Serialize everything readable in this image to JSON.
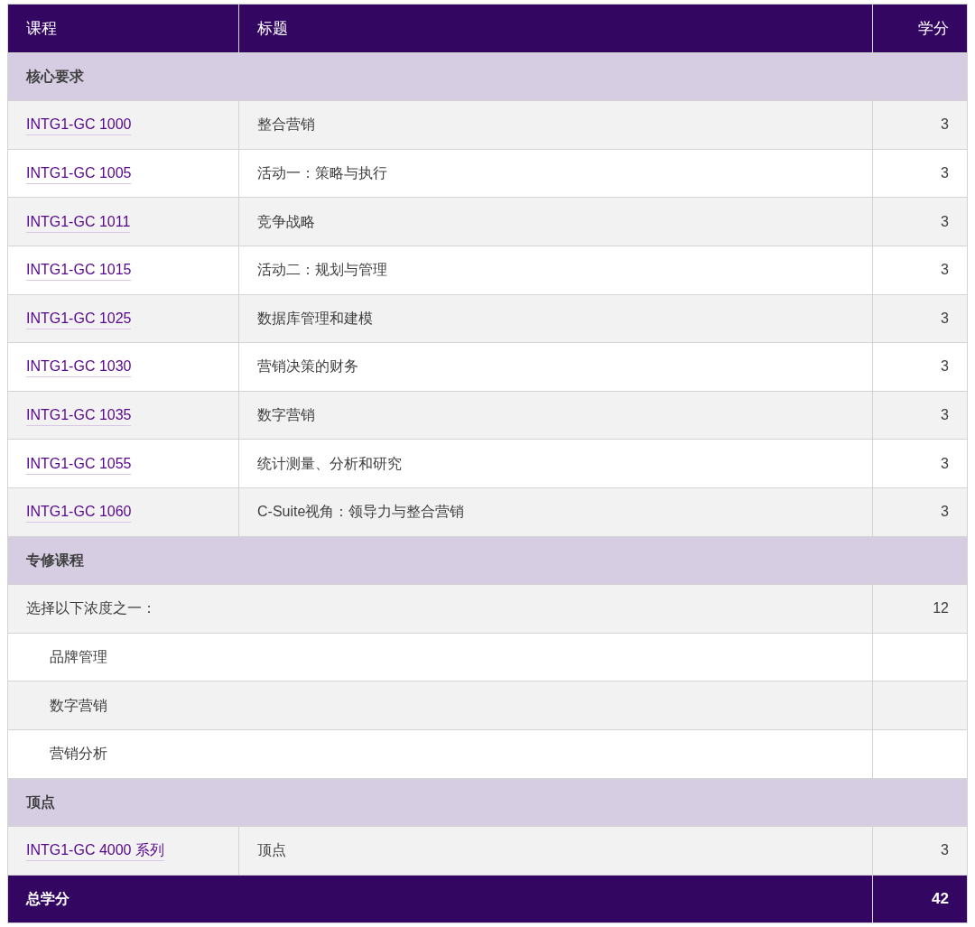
{
  "table": {
    "columns": [
      "课程",
      "标题",
      "学分"
    ],
    "sections": [
      {
        "title": "核心要求",
        "rows": [
          {
            "kind": "course",
            "code": "INTG1-GC 1000",
            "title": "整合营销",
            "credits": "3"
          },
          {
            "kind": "course",
            "code": "INTG1-GC 1005",
            "title": "活动一：策略与执行",
            "credits": "3"
          },
          {
            "kind": "course",
            "code": "INTG1-GC 1011",
            "title": "竞争战略",
            "credits": "3"
          },
          {
            "kind": "course",
            "code": "INTG1-GC 1015",
            "title": "活动二：规划与管理",
            "credits": "3"
          },
          {
            "kind": "course",
            "code": "INTG1-GC 1025",
            "title": "数据库管理和建模",
            "credits": "3"
          },
          {
            "kind": "course",
            "code": "INTG1-GC 1030",
            "title": "营销决策的财务",
            "credits": "3"
          },
          {
            "kind": "course",
            "code": "INTG1-GC 1035",
            "title": "数字营销",
            "credits": "3"
          },
          {
            "kind": "course",
            "code": "INTG1-GC 1055",
            "title": "统计测量、分析和研究",
            "credits": "3"
          },
          {
            "kind": "course",
            "code": "INTG1-GC 1060",
            "title": "C-Suite视角：领导力与整合营销",
            "credits": "3"
          }
        ]
      },
      {
        "title": "专修课程",
        "rows": [
          {
            "kind": "note",
            "text": "选择以下浓度之一：",
            "credits": "12"
          },
          {
            "kind": "option",
            "text": "品牌管理"
          },
          {
            "kind": "option",
            "text": "数字营销"
          },
          {
            "kind": "option",
            "text": "营销分析"
          }
        ]
      },
      {
        "title": "顶点",
        "rows": [
          {
            "kind": "course",
            "code": "INTG1-GC 4000 系列",
            "title": "顶点",
            "credits": "3"
          }
        ]
      }
    ],
    "footer": {
      "label": "总学分",
      "total": "42"
    }
  }
}
